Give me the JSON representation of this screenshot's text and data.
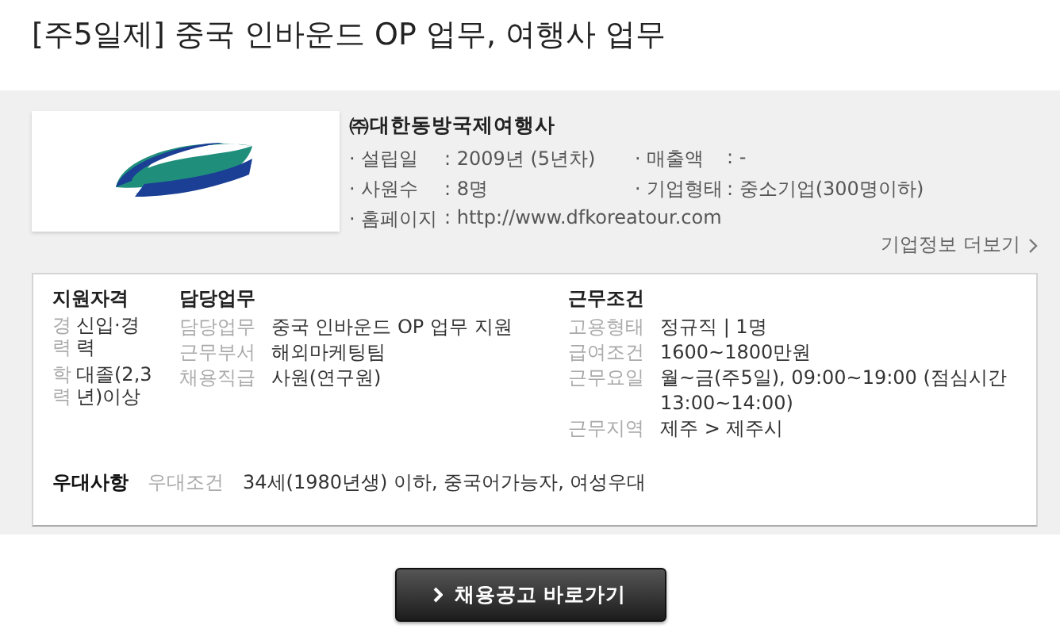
{
  "title": "[주5일제] 중국 인바운드 OP 업무, 여행사 업무",
  "company": {
    "name": "㈜대한동방국제여행사",
    "facts": [
      {
        "label": "· 설립일",
        "value": ": 2009년 (5년차)"
      },
      {
        "label": "· 매출액",
        "value": ": -"
      },
      {
        "label": "· 사원수",
        "value": ": 8명"
      },
      {
        "label": "· 기업형태",
        "value": ": 중소기업(300명이하)"
      },
      {
        "label": "· 홈페이지",
        "value": ": http://www.dfkoreatour.com"
      }
    ],
    "more_link": "기업정보 더보기"
  },
  "qualification": {
    "heading": "지원자격",
    "rows": [
      {
        "label": "경력",
        "value": "신입·경력"
      },
      {
        "label": "학력",
        "value": "대졸(2,3년)이상"
      }
    ]
  },
  "duties": {
    "heading": "담당업무",
    "rows": [
      {
        "label": "담당업무",
        "value": "중국 인바운드 OP 업무 지원"
      },
      {
        "label": "근무부서",
        "value": "해외마케팅팀"
      },
      {
        "label": "채용직급",
        "value": "사원(연구원)"
      }
    ]
  },
  "conditions": {
    "heading": "근무조건",
    "rows": [
      {
        "label": "고용형태",
        "value": "정규직 | 1명"
      },
      {
        "label": "급여조건",
        "value": "1600~1800만원"
      },
      {
        "label": "근무요일",
        "value": "월~금(주5일), 09:00~19:00 (점심시간 13:00~14:00)"
      },
      {
        "label": "근무지역",
        "value": "제주 > 제주시"
      }
    ]
  },
  "preference": {
    "heading": "우대사항",
    "label": "우대조건",
    "value": "34세(1980년생) 이하, 중국어가능자, 여성우대"
  },
  "apply_button": "채용공고 바로가기"
}
